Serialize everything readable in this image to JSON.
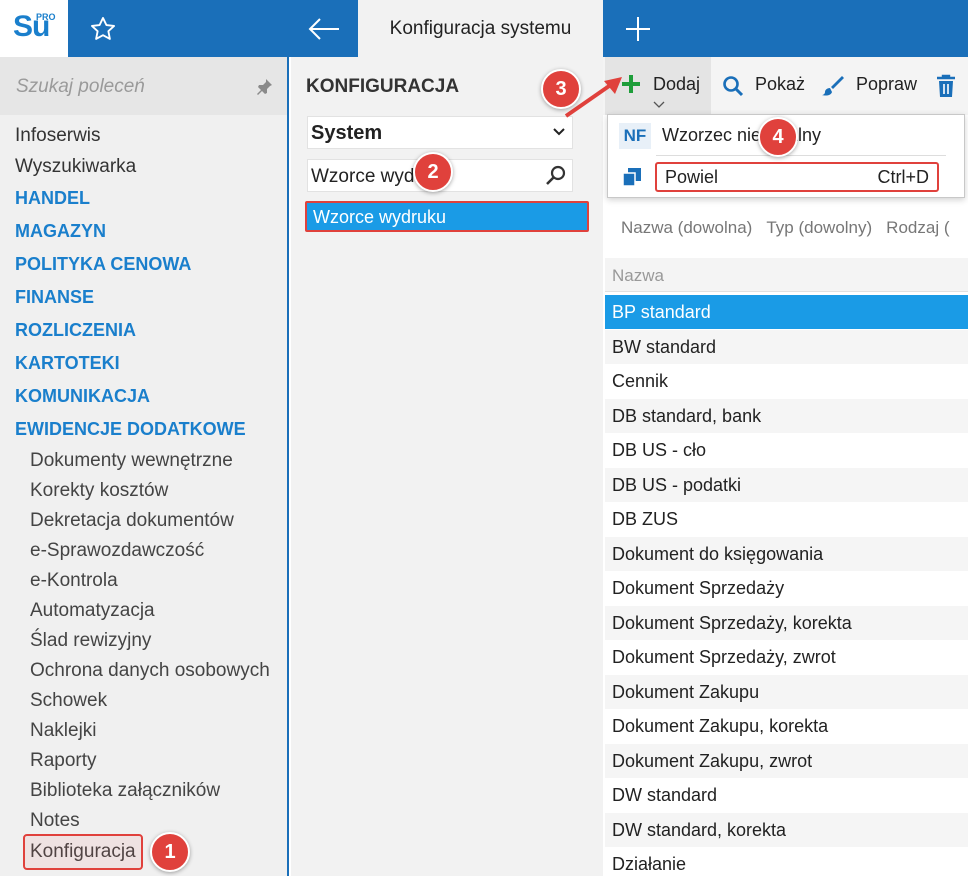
{
  "logo": {
    "text": "Su",
    "badge": "PRO"
  },
  "topbar": {
    "active_tab": "Konfiguracja systemu"
  },
  "sidebar": {
    "search_placeholder": "Szukaj poleceń",
    "items": [
      {
        "label": "Infoserwis",
        "kind": "plain"
      },
      {
        "label": "Wyszukiwarka",
        "kind": "plain"
      },
      {
        "label": "HANDEL",
        "kind": "section"
      },
      {
        "label": "MAGAZYN",
        "kind": "section"
      },
      {
        "label": "POLITYKA CENOWA",
        "kind": "section"
      },
      {
        "label": "FINANSE",
        "kind": "section"
      },
      {
        "label": "ROZLICZENIA",
        "kind": "section"
      },
      {
        "label": "KARTOTEKI",
        "kind": "section"
      },
      {
        "label": "KOMUNIKACJA",
        "kind": "section"
      },
      {
        "label": "EWIDENCJE DODATKOWE",
        "kind": "section"
      },
      {
        "label": "Dokumenty wewnętrzne",
        "kind": "sub"
      },
      {
        "label": "Korekty kosztów",
        "kind": "sub"
      },
      {
        "label": "Dekretacja dokumentów",
        "kind": "sub"
      },
      {
        "label": "e-Sprawozdawczość",
        "kind": "sub"
      },
      {
        "label": "e-Kontrola",
        "kind": "sub"
      },
      {
        "label": "Automatyzacja",
        "kind": "sub"
      },
      {
        "label": "Ślad rewizyjny",
        "kind": "sub"
      },
      {
        "label": "Ochrona danych osobowych",
        "kind": "sub"
      },
      {
        "label": "Schowek",
        "kind": "sub"
      },
      {
        "label": "Naklejki",
        "kind": "sub"
      },
      {
        "label": "Raporty",
        "kind": "sub"
      },
      {
        "label": "Biblioteka załączników",
        "kind": "sub"
      },
      {
        "label": "Notes",
        "kind": "sub"
      },
      {
        "label": "Konfiguracja",
        "kind": "sub"
      }
    ]
  },
  "config_panel": {
    "heading": "KONFIGURACJA",
    "select_value": "System",
    "search_value": "Wzorce wydruku",
    "selected_item": "Wzorce wydruku"
  },
  "toolbar": {
    "add": "Dodaj",
    "show": "Pokaż",
    "edit": "Popraw"
  },
  "dropdown": {
    "nf_badge": "NF",
    "nf_label": "Wzorzec niefiskalny",
    "duplicate_label": "Powiel",
    "duplicate_shortcut": "Ctrl+D"
  },
  "filters": [
    "Nazwa (dowolna)",
    "Typ (dowolny)",
    "Rodzaj ("
  ],
  "table": {
    "column": "Nazwa",
    "selected_index": 0,
    "rows": [
      "BP standard",
      "BW standard",
      "Cennik",
      "DB standard, bank",
      "DB US - cło",
      "DB US - podatki",
      "DB ZUS",
      "Dokument do księgowania",
      "Dokument Sprzedaży",
      "Dokument Sprzedaży, korekta",
      "Dokument Sprzedaży, zwrot",
      "Dokument Zakupu",
      "Dokument Zakupu, korekta",
      "Dokument Zakupu, zwrot",
      "DW standard",
      "DW standard, korekta",
      "Działanie"
    ]
  },
  "markers": [
    "1",
    "2",
    "3",
    "4"
  ],
  "colors": {
    "brand": "#1a6fb9",
    "selection": "#1a9be6",
    "section": "#1a7fcc",
    "annotation": "#e0413c",
    "add_icon": "#1e9e3a"
  }
}
